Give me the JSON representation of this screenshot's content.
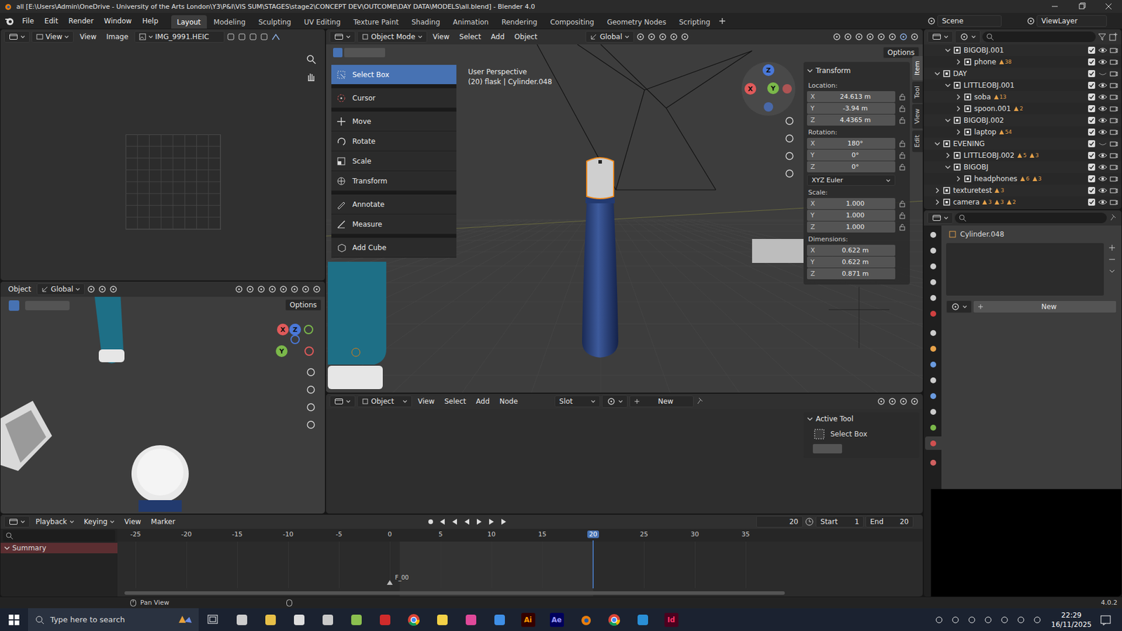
{
  "window": {
    "title": "all [E:\\Users\\Admin\\OneDrive - University of the Arts London\\Y3\\P&I\\VIS SUM\\STAGES\\stage2\\CONCEPT DEV\\OUTCOME\\DAY DATA\\MODELS\\all.blend] - Blender 4.0"
  },
  "menubar": [
    "File",
    "Edit",
    "Render",
    "Window",
    "Help"
  ],
  "workspaces": [
    {
      "label": "Layout",
      "selected": true
    },
    {
      "label": "Modeling",
      "selected": false
    },
    {
      "label": "Sculpting",
      "selected": false
    },
    {
      "label": "UV Editing",
      "selected": false
    },
    {
      "label": "Texture Paint",
      "selected": false
    },
    {
      "label": "Shading",
      "selected": false
    },
    {
      "label": "Animation",
      "selected": false
    },
    {
      "label": "Rendering",
      "selected": false
    },
    {
      "label": "Compositing",
      "selected": false
    },
    {
      "label": "Geometry Nodes",
      "selected": false
    },
    {
      "label": "Scripting",
      "selected": false
    }
  ],
  "scene": "Scene",
  "view_layer": "ViewLayer",
  "image_editor": {
    "view_mode": "View",
    "menus": [
      "View",
      "Image"
    ],
    "image": "IMG_9991.HEIC"
  },
  "left_viewport": {
    "mode": "Object",
    "orientation": "Global",
    "options": "Options",
    "gizmo": [
      "X",
      "Z",
      "Y"
    ]
  },
  "viewport": {
    "mode": "Object Mode",
    "menus": [
      "View",
      "Select",
      "Add",
      "Object"
    ],
    "orientation": "Global",
    "options": "Options",
    "info": [
      "User Perspective",
      "(20) flask | Cylinder.048"
    ],
    "gizmo": {
      "x": "X",
      "y": "Y",
      "z": "Z"
    },
    "tool_menu": [
      {
        "label": "Select Box",
        "selected": true
      },
      {
        "label": "Cursor",
        "selected": false
      },
      {
        "label": "Move",
        "selected": false
      },
      {
        "label": "Rotate",
        "selected": false
      },
      {
        "label": "Scale",
        "selected": false
      },
      {
        "label": "Transform",
        "selected": false
      },
      {
        "label": "Annotate",
        "selected": false
      },
      {
        "label": "Measure",
        "selected": false
      },
      {
        "label": "Add Cube",
        "selected": false
      }
    ],
    "sidebar_tabs": [
      {
        "label": "Item",
        "selected": true
      },
      {
        "label": "Tool",
        "selected": false
      },
      {
        "label": "View",
        "selected": false
      },
      {
        "label": "Edit",
        "selected": false
      }
    ],
    "transform": {
      "title": "Transform",
      "location": {
        "label": "Location:",
        "rows": [
          {
            "axis": "X",
            "value": "24.613 m"
          },
          {
            "axis": "Y",
            "value": "-3.94 m"
          },
          {
            "axis": "Z",
            "value": "4.4365 m"
          }
        ]
      },
      "rotation": {
        "label": "Rotation:",
        "rows": [
          {
            "axis": "X",
            "value": "180°"
          },
          {
            "axis": "Y",
            "value": "0°"
          },
          {
            "axis": "Z",
            "value": "0°"
          }
        ],
        "mode": "XYZ Euler"
      },
      "scale": {
        "label": "Scale:",
        "rows": [
          {
            "axis": "X",
            "value": "1.000"
          },
          {
            "axis": "Y",
            "value": "1.000"
          },
          {
            "axis": "Z",
            "value": "1.000"
          }
        ]
      },
      "dimensions": {
        "label": "Dimensions:",
        "rows": [
          {
            "axis": "X",
            "value": "0.622 m"
          },
          {
            "axis": "Y",
            "value": "0.622 m"
          },
          {
            "axis": "Z",
            "value": "0.871 m"
          }
        ]
      }
    }
  },
  "node_editor": {
    "mode": "Object",
    "menus": [
      "View",
      "Select",
      "Add",
      "Node"
    ],
    "slot": "Slot",
    "new": "New",
    "active_tool": {
      "title": "Active Tool",
      "tool": "Select Box"
    }
  },
  "outliner": {
    "rows": [
      {
        "name": "BIGOBJ.001",
        "depth": 1,
        "expanded": true,
        "checked": true,
        "visible": true,
        "badges": []
      },
      {
        "name": "phone",
        "depth": 2,
        "expanded": false,
        "checked": true,
        "visible": true,
        "badges": [
          "38"
        ]
      },
      {
        "name": "DAY",
        "depth": 0,
        "expanded": true,
        "checked": true,
        "visible": false,
        "badges": []
      },
      {
        "name": "LITTLEOBJ.001",
        "depth": 1,
        "expanded": true,
        "checked": true,
        "visible": true,
        "badges": []
      },
      {
        "name": "soba",
        "depth": 2,
        "expanded": false,
        "checked": true,
        "visible": true,
        "badges": [
          "13"
        ]
      },
      {
        "name": "spoon.001",
        "depth": 2,
        "expanded": false,
        "checked": true,
        "visible": true,
        "badges": [
          "2"
        ]
      },
      {
        "name": "BIGOBJ.002",
        "depth": 1,
        "expanded": true,
        "checked": true,
        "visible": true,
        "badges": []
      },
      {
        "name": "laptop",
        "depth": 2,
        "expanded": false,
        "checked": true,
        "visible": true,
        "badges": [
          "54"
        ]
      },
      {
        "name": "EVENING",
        "depth": 0,
        "expanded": true,
        "checked": true,
        "visible": false,
        "badges": []
      },
      {
        "name": "LITTLEOBJ.002",
        "depth": 1,
        "expanded": false,
        "checked": true,
        "visible": true,
        "badges": [
          "5",
          "3"
        ]
      },
      {
        "name": "BIGOBJ",
        "depth": 1,
        "expanded": true,
        "checked": true,
        "visible": true,
        "badges": []
      },
      {
        "name": "headphones",
        "depth": 2,
        "expanded": false,
        "checked": true,
        "visible": true,
        "badges": [
          "6",
          "3"
        ]
      },
      {
        "name": "texturetest",
        "depth": 0,
        "expanded": false,
        "checked": true,
        "visible": true,
        "badges": [
          "3"
        ]
      },
      {
        "name": "camera",
        "depth": 0,
        "expanded": false,
        "checked": true,
        "visible": true,
        "badges": [
          "3",
          "3",
          "2"
        ]
      }
    ]
  },
  "properties": {
    "tabs": [
      {
        "selected": false
      },
      {
        "selected": false
      },
      {
        "selected": false
      },
      {
        "selected": false
      },
      {
        "selected": false
      },
      {
        "selected": false
      },
      {
        "selected": false
      },
      {
        "selected": false
      },
      {
        "selected": false
      },
      {
        "selected": false
      },
      {
        "selected": false
      },
      {
        "selected": false
      },
      {
        "selected": false
      },
      {
        "selected": true
      },
      {
        "selected": false
      }
    ],
    "object": "Cylinder.048",
    "new": "New"
  },
  "timeline": {
    "menus": [
      "Playback",
      "Keying",
      "View",
      "Marker"
    ],
    "current": "20",
    "start_label": "Start",
    "start": "1",
    "end_label": "End",
    "end": "20",
    "ticks": [
      "-25",
      "-20",
      "-15",
      "-10",
      "-5",
      "0",
      "5",
      "10",
      "15",
      "20",
      "25",
      "30",
      "35"
    ],
    "channel": "Summary",
    "marker": "F_00"
  },
  "status_bar": {
    "hint": "Pan View",
    "version": "4.0.2"
  },
  "taskbar": {
    "search": "Type here to search",
    "apps": [
      {
        "label": "Ai"
      },
      {
        "label": "Ae"
      },
      {
        "label": "Id"
      }
    ],
    "time": "22:29",
    "date": "16/11/2025"
  }
}
